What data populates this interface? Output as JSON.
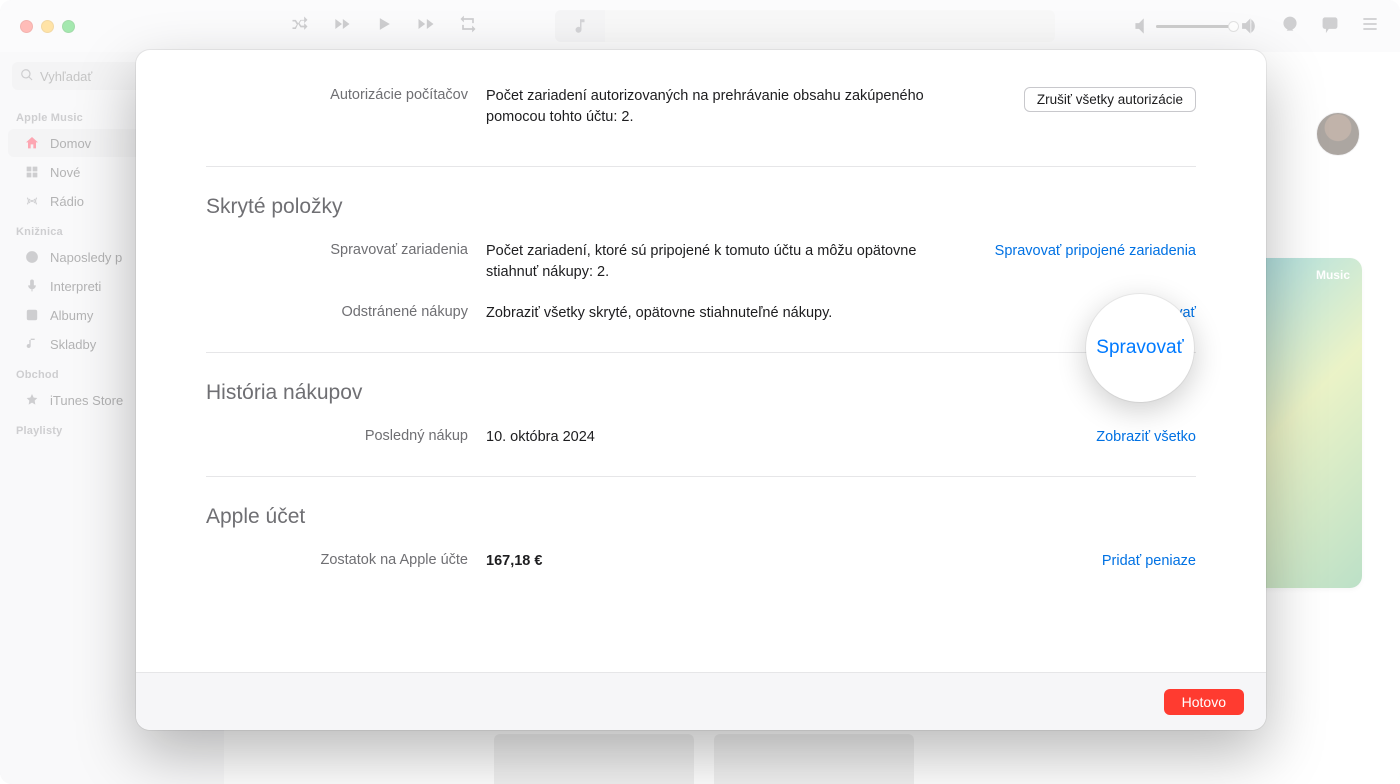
{
  "search": {
    "placeholder": "Vyhľadať"
  },
  "sidebar": {
    "heading_music": "Apple Music",
    "items_music": [
      {
        "label": "Domov"
      },
      {
        "label": "Nové"
      },
      {
        "label": "Rádio"
      }
    ],
    "heading_library": "Knižnica",
    "items_library": [
      {
        "label": "Naposledy p"
      },
      {
        "label": "Interpreti"
      },
      {
        "label": "Albumy"
      },
      {
        "label": "Skladby"
      }
    ],
    "heading_store": "Obchod",
    "items_store": [
      {
        "label": "iTunes Store"
      }
    ],
    "heading_playlists": "Playlisty"
  },
  "music_card_label": "Music",
  "modal": {
    "auth_label": "Autorizácie počítačov",
    "auth_text": "Počet zariadení autorizovaných na prehrávanie obsahu zakúpeného pomocou tohto účtu: 2.",
    "auth_button": "Zrušiť všetky autorizácie",
    "hidden_title": "Skryté položky",
    "devices_label": "Spravovať zariadenia",
    "devices_text": "Počet zariadení, ktoré sú pripojené k tomuto účtu a môžu opätovne stiahnuť nákupy: 2.",
    "devices_link": "Spravovať pripojené zariadenia",
    "removed_label": "Odstránené nákupy",
    "removed_text": "Zobraziť všetky skryté, opätovne stiahnuteľné nákupy.",
    "removed_link": "Spravovať",
    "history_title": "História nákupov",
    "last_label": "Posledný nákup",
    "last_value": "10. októbra 2024",
    "history_link": "Zobraziť všetko",
    "account_title": "Apple účet",
    "balance_label": "Zostatok na Apple účte",
    "balance_value": "167,18 €",
    "balance_link": "Pridať peniaze",
    "done": "Hotovo"
  },
  "magnify": {
    "label": "Spravovať"
  }
}
